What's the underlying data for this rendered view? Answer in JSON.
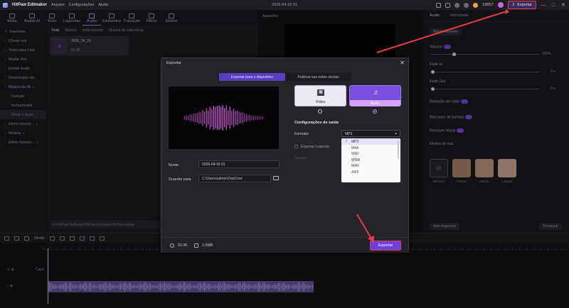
{
  "app": {
    "name": "HitPaw Edimakor",
    "menus": [
      "Arquivo",
      "Configurações",
      "Ajuda"
    ],
    "project_title": "2026-04-16 01",
    "credits": "13657",
    "export_label": "Exportar",
    "window_controls": [
      "—",
      "□",
      "✕"
    ]
  },
  "toolbar": {
    "items": [
      {
        "label": "Mídia"
      },
      {
        "label": "Avatar AI"
      },
      {
        "label": "Texto"
      },
      {
        "label": "Legendas"
      },
      {
        "label": "Áudio"
      },
      {
        "label": "Elementos"
      },
      {
        "label": "Transição"
      },
      {
        "label": "Filtros"
      },
      {
        "label": "Efeitos"
      }
    ]
  },
  "sidebar": {
    "items": [
      {
        "label": "Favoritos"
      },
      {
        "label": "Clonar voz"
      },
      {
        "label": "Texto para Fala"
      },
      {
        "label": "Mudar Voz"
      },
      {
        "label": "Extrair áudio"
      },
      {
        "label": "Downloader do..."
      },
      {
        "label": "Música de IA"
      },
      {
        "label": "Canção"
      },
      {
        "label": "Instrumental"
      },
      {
        "label": "Mixar e ajust..."
      },
      {
        "label": "Efeito sonoro..."
      },
      {
        "label": "Música"
      },
      {
        "label": "Efeito Sonoro..."
      }
    ]
  },
  "media": {
    "tabs": [
      "Todo",
      "Básico",
      "Instrumental",
      "Música de referência"
    ],
    "item_name": "2026_04_16",
    "item_duration": "01:36",
    "path": "D:/HitPaw Software/HitPaw Edimakor/AI Generation"
  },
  "preview": {
    "label": "Aparelho"
  },
  "right_panel": {
    "tabs": [
      "Áudio",
      "Velocidade"
    ],
    "basic_label": "Básico",
    "reset_label": "Reverter",
    "volume_label": "Volume",
    "volume_value": "100%",
    "fade_in_label": "Fade In",
    "fade_in_value": "0 s",
    "fade_out_label": "Fade Out",
    "fade_out_value": "0 s",
    "noise_label": "Redução de ruído",
    "beat_label": "Marcador de batidas",
    "vocal_label": "Remover Vocal",
    "voice_effects_label": "Efeitos de voz",
    "voices": [
      "Nenhum",
      "Homem",
      "Mulher",
      "Criança"
    ],
    "auto_subtitles": "Auto-legendas",
    "restore_label": "Restaurar"
  },
  "timeline": {
    "divide_label": "Divide",
    "clip_label": "Capa"
  },
  "dialog": {
    "title": "Exportar",
    "tabs": [
      "Exportar para o dispositivo",
      "Publicar nas redes sociais"
    ],
    "name_label": "Nome",
    "name_value": "2026-04-16 01",
    "save_label": "Guardar para",
    "save_path": "C:\\Users\\admin\\OneDrive",
    "types": [
      {
        "label": "Vídeo",
        "icon": "clapper-icon"
      },
      {
        "label": "Áudio",
        "icon": "music-note-icon"
      }
    ],
    "output_title": "Configurações de saída",
    "format_label": "Formato",
    "format_value": "MP3",
    "subtitle_label": "Exportar Legenda",
    "format_label2": "Formato",
    "format_options": [
      "MP3",
      "M4A",
      "WAV",
      "WMA",
      "M4R",
      "AIFF"
    ],
    "duration": "01:36",
    "size": "1.5MB",
    "export_button": "Exportar"
  },
  "colors": {
    "accent": "#6c3fe0",
    "highlight": "#e8384b",
    "waveform": "#e060e8"
  }
}
